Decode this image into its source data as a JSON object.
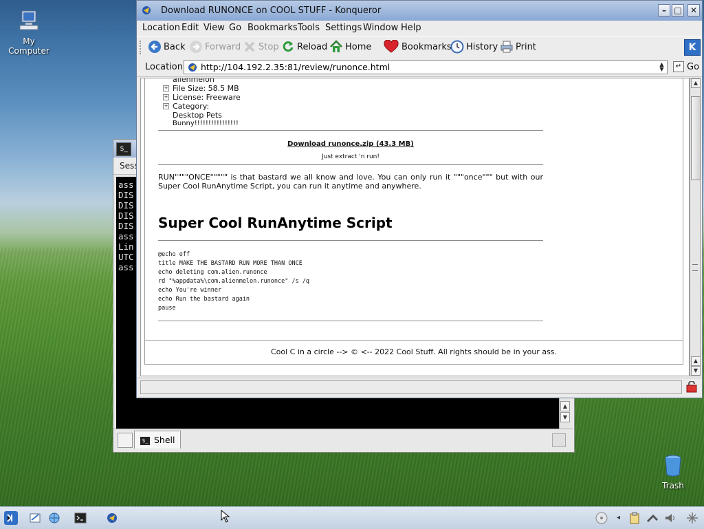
{
  "desktop": {
    "icons": [
      {
        "label_line1": "My",
        "label_line2": "Computer"
      },
      {
        "label": "Trash"
      }
    ]
  },
  "konsole": {
    "menu_fragment": "Sess",
    "terminal_lines": [
      "ass",
      "DIS",
      "DIS",
      "DIS",
      "DIS",
      "ass",
      "Lin",
      "UTC",
      "ass"
    ],
    "tab_label": "Shell"
  },
  "browser": {
    "window_title": "Download RUNONCE on COOL STUFF - Konqueror",
    "menu": [
      "Location",
      "Edit",
      "View",
      "Go",
      "Bookmarks",
      "Tools",
      "Settings",
      "Window",
      "Help"
    ],
    "toolbar": {
      "back": "Back",
      "forward": "Forward",
      "stop": "Stop",
      "reload": "Reload",
      "home": "Home",
      "bookmarks": "Bookmarks",
      "history": "History",
      "print": "Print"
    },
    "location_label": "Location:",
    "url": "http://104.192.2.35:81/review/runonce.html",
    "go_label": "Go"
  },
  "page": {
    "author_partial": "alienmelon",
    "file_size": "File Size: 58.5 MB",
    "license": "License: Freeware",
    "category_label": "Category:",
    "category_values": [
      "Desktop Pets",
      "Bunny!!!!!!!!!!!!!!!!"
    ],
    "download_link": "Download runonce.zip (43.3 MB)",
    "download_sub": "Just extract 'n run!",
    "description": "RUN\"\"\"\"ONCE\"\"\"\"\" is that bastard we all know and love. You can only run it \"\"\"once\"\"\" but with our Super Cool RunAnytime Script, you can run it anytime and anywhere.",
    "script_heading": "Super Cool RunAnytime Script",
    "code_lines": [
      "@echo off",
      "title MAKE THE BASTARD RUN MORE THAN ONCE",
      "echo deleting com.alien.runonce",
      "rd \"%appdata%\\com.alienmelon.runonce\" /s /q",
      "echo You're winner",
      "echo Run the bastard again",
      "pause"
    ],
    "footer": "Cool C in a circle --> © <-- 2022 Cool Stuff. All rights should be in your ass."
  },
  "colors": {
    "titlebar": "#9fb7dd",
    "link": "#111111",
    "reload_green": "#2e9b3c",
    "bookmark_red": "#d8242c"
  },
  "icons": {
    "back": "back-arrow-icon",
    "forward": "forward-arrow-icon",
    "stop": "stop-x-icon",
    "reload": "reload-icon",
    "home": "home-icon",
    "bookmarks": "heart-bookmark-icon",
    "history": "clock-icon",
    "print": "printer-icon"
  }
}
